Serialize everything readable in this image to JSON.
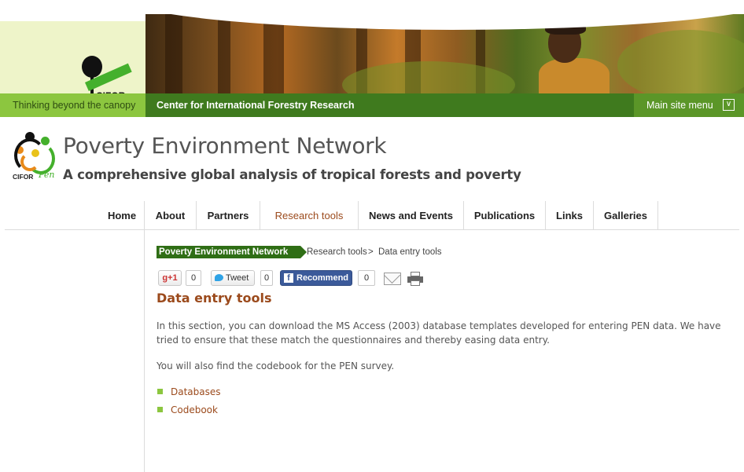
{
  "banner": {
    "logo_text": "CIFOR",
    "tagline": "Thinking beyond the canopy",
    "center_title": "Center for International Forestry Research",
    "main_menu_label": "Main site menu"
  },
  "site": {
    "logo_text": "CIFOR",
    "logo_script": "Pen",
    "title": "Poverty Environment Network",
    "subtitle": "A comprehensive global analysis of tropical forests and poverty"
  },
  "nav": {
    "items": [
      {
        "label": "Home"
      },
      {
        "label": "About"
      },
      {
        "label": "Partners"
      },
      {
        "label": "Research tools"
      },
      {
        "label": "News and Events"
      },
      {
        "label": "Publications"
      },
      {
        "label": "Links"
      },
      {
        "label": "Galleries"
      }
    ],
    "active": "Research tools"
  },
  "breadcrumb": {
    "home": "Poverty Environment Network",
    "middle": "Research tools",
    "separator": ">",
    "current": "Data entry tools"
  },
  "share": {
    "gplus_label": "+1",
    "gplus_count": "0",
    "tweet_label": "Tweet",
    "tweet_count": "0",
    "fb_label": "Recommend",
    "fb_count": "0"
  },
  "content": {
    "title": "Data entry tools",
    "para1": "In this section, you can download the MS Access (2003) database templates developed for entering PEN data. We have tried to ensure that these match the questionnaires and thereby easing data entry.",
    "para2": "You will also find the codebook for the PEN survey.",
    "links": [
      {
        "label": "Databases"
      },
      {
        "label": "Codebook"
      }
    ]
  },
  "colors": {
    "accent_green": "#8cc63f",
    "dark_green": "#3f7a1e",
    "link_brown": "#9b4a1c",
    "facebook_blue": "#3b5a9a"
  }
}
